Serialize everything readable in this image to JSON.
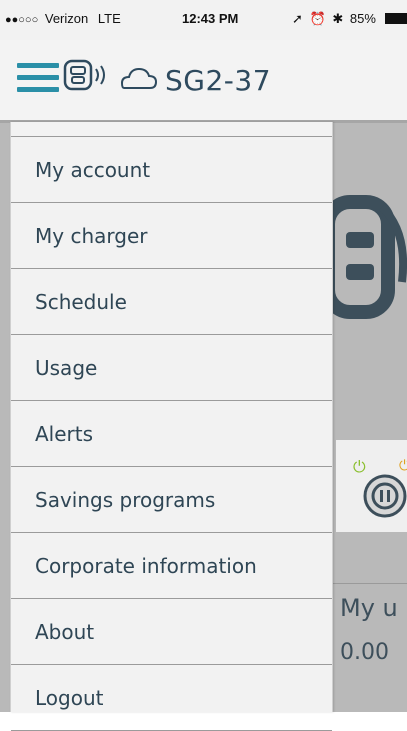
{
  "status_bar": {
    "signal": "●●○○○",
    "carrier": "Verizon",
    "network": "LTE",
    "time": "12:43 PM",
    "icons": [
      "location-arrow-icon",
      "alarm-icon",
      "bluetooth-icon"
    ],
    "battery_percent": "85%"
  },
  "header": {
    "title": "SG2-37",
    "menu_icon": "hamburger-menu-icon",
    "device_icon": "charger-wireless-icon",
    "cloud_icon": "cloud-icon",
    "accent_color": "#2a8fa7",
    "title_color": "#2e4a5e"
  },
  "menu": {
    "items": [
      {
        "label": "My account"
      },
      {
        "label": "My charger"
      },
      {
        "label": "Schedule"
      },
      {
        "label": "Usage"
      },
      {
        "label": "Alerts"
      },
      {
        "label": "Savings programs"
      },
      {
        "label": "Corporate information"
      },
      {
        "label": "About"
      },
      {
        "label": "Logout"
      }
    ]
  },
  "background": {
    "usage_title": "My u",
    "usage_value": "0.00"
  }
}
